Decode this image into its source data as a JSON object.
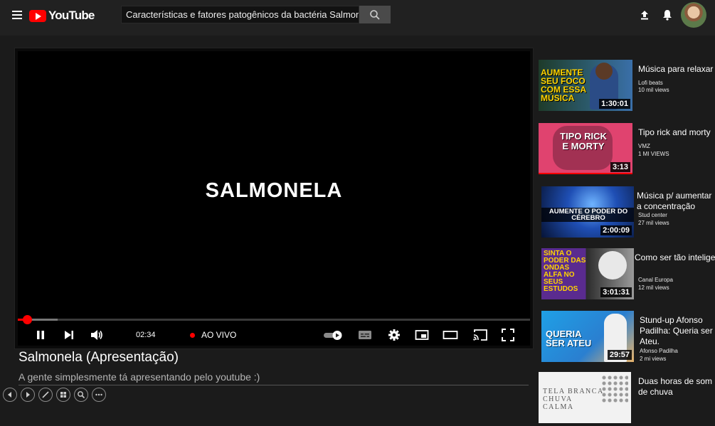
{
  "header": {
    "logo_text": "YouTube",
    "search_value": "Características e fatores patogênicos da bactéria Salmonela"
  },
  "player": {
    "slide_title": "SALMONELA",
    "time": "02:34",
    "live_label": "AO VIVO",
    "progress_fraction": 0.018,
    "buffer_fraction": 0.078
  },
  "video": {
    "title": "Salmonela (Apresentação)",
    "description": "A gente simplesmente tá apresentando pelo youtube :)"
  },
  "recommendations": [
    {
      "title": "Música para relaxar",
      "channel": "Lofi beats",
      "views": "10 mil views",
      "duration": "1:30:01",
      "thumb_text": "AUMENTE SEU FOCO COM ESSA MÚSICA"
    },
    {
      "title": "Tipo rick and morty",
      "channel": "VMZ",
      "views": "1 MI VIEWS",
      "duration": "3:13",
      "thumb_text": "TIPO RICK E MORTY"
    },
    {
      "title": "Música p/ aumentar a concentração",
      "channel": "Stud center",
      "views": "27 mil views",
      "duration": "2:00:09",
      "thumb_text": "AUMENTE O PODER DO CÉREBRO"
    },
    {
      "title": "Como ser tão inteligente quanto Quanto Einstein?",
      "title_display": "Como ser tão inteliger Quanto Einstein?",
      "channel": "Canal Europa",
      "views": "12 mil views",
      "duration": "3:01:31",
      "thumb_text": "SINTA O PODER DAS ONDAS ALFA NO SEUS ESTUDOS"
    },
    {
      "title": "Stund-up Afonso Padilha: Queria ser Ateu.",
      "channel": "Afonso Padilha",
      "views": "2 mi views",
      "duration": "29:57",
      "thumb_text": "QUERIA SER ATEU"
    },
    {
      "title": "Duas horas de som de chuva",
      "channel": "",
      "views": "",
      "duration": "",
      "thumb_text": "TELA BRANCA CHUVA CALMA"
    }
  ],
  "colors": {
    "accent": "#ff0000",
    "background": "#1b1b1b",
    "topbar": "#212121"
  }
}
